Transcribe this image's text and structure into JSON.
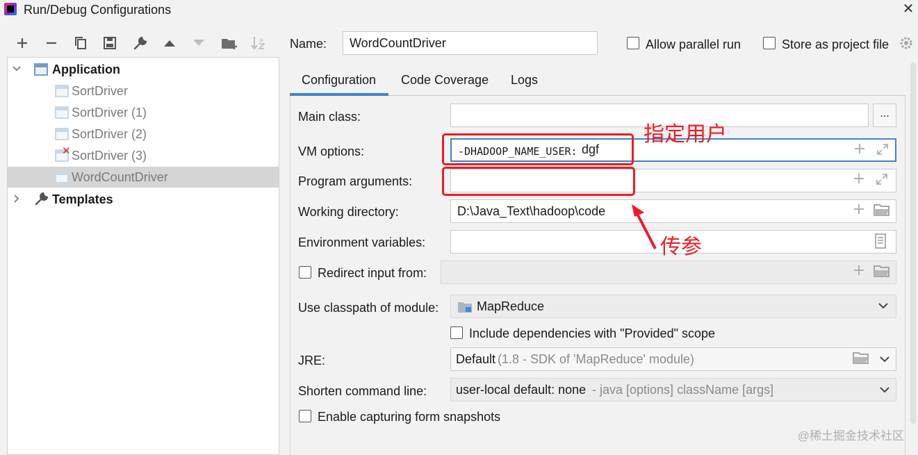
{
  "window": {
    "title": "Run/Debug Configurations",
    "close_glyph": "✕"
  },
  "toolbar": {
    "icons": [
      "add-icon",
      "remove-icon",
      "copy-icon",
      "save-icon",
      "wrench-icon",
      "arrow-up-icon",
      "arrow-down-icon",
      "folder-add-icon",
      "sort-icon"
    ]
  },
  "tree": {
    "application_label": "Application",
    "items": [
      {
        "label": "SortDriver"
      },
      {
        "label": "SortDriver (1)"
      },
      {
        "label": "SortDriver (2)"
      },
      {
        "label": "SortDriver (3)"
      },
      {
        "label": "WordCountDriver"
      }
    ],
    "templates_label": "Templates"
  },
  "header": {
    "name_label": "Name:",
    "name_value": "WordCountDriver",
    "allow_parallel_label": "Allow parallel run",
    "store_project_label": "Store as project file"
  },
  "tabs": [
    {
      "label": "Configuration"
    },
    {
      "label": "Code Coverage"
    },
    {
      "label": "Logs"
    }
  ],
  "form": {
    "main_class_label": "Main class:",
    "main_class_value": "",
    "ellipsis": "...",
    "vm_options_label": "VM options:",
    "vm_options_value_mono": "-DHADOOP_NAME_USER:",
    "vm_options_value_user": "dgf",
    "program_args_label": "Program arguments:",
    "program_args_value": "",
    "working_dir_label": "Working directory:",
    "working_dir_value": "D:\\Java_Text\\hadoop\\code",
    "env_vars_label": "Environment variables:",
    "redirect_label": "Redirect input from:",
    "classpath_label": "Use classpath of module:",
    "classpath_value": "MapReduce",
    "include_deps_label": "Include dependencies with \"Provided\" scope",
    "jre_label": "JRE:",
    "jre_value": "Default",
    "jre_detail": "(1.8 - SDK of 'MapReduce' module)",
    "shorten_label": "Shorten command line:",
    "shorten_value": "user-local default: none",
    "shorten_detail": "- java [options] className [args]",
    "snapshot_label": "Enable capturing form snapshots"
  },
  "annotations": {
    "user_note": "指定用户",
    "args_note": "传参"
  },
  "watermark": "@稀土掘金技术社区",
  "colors": {
    "accent": "#4083c9",
    "annotation_red": "#ec1c24",
    "selected_row": "#d5d5d5"
  }
}
